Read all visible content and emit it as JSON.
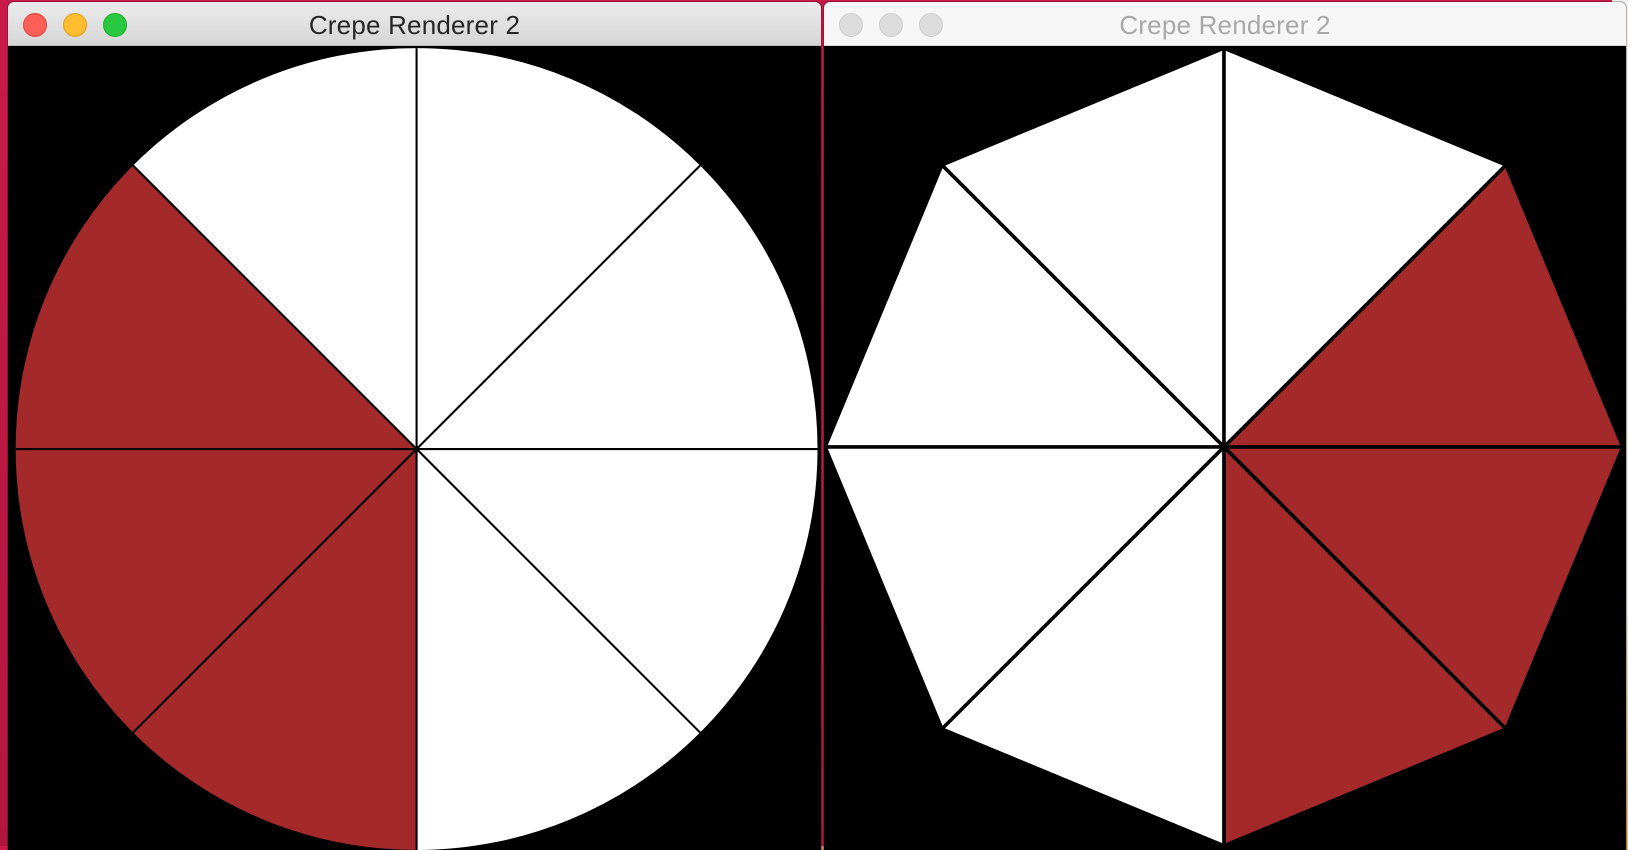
{
  "windows": [
    {
      "title": "Crepe Renderer 2",
      "state": "active",
      "shape": "circle",
      "segments": 8,
      "red_slices": [
        3,
        4,
        5
      ],
      "wedge_fill": "#ffffff",
      "highlight_fill": "#a3292b",
      "background": "#000000"
    },
    {
      "title": "Crepe Renderer 2",
      "state": "inactive",
      "shape": "octagon",
      "segments": 8,
      "red_slices": [
        4,
        5,
        6
      ],
      "wedge_fill": "#ffffff",
      "highlight_fill": "#a3292b",
      "background": "#000000"
    }
  ],
  "traffic_lights": {
    "close": "#fe5f57",
    "minimize": "#febc2e",
    "zoom": "#28c840",
    "inactive": "#dcdcdc"
  }
}
